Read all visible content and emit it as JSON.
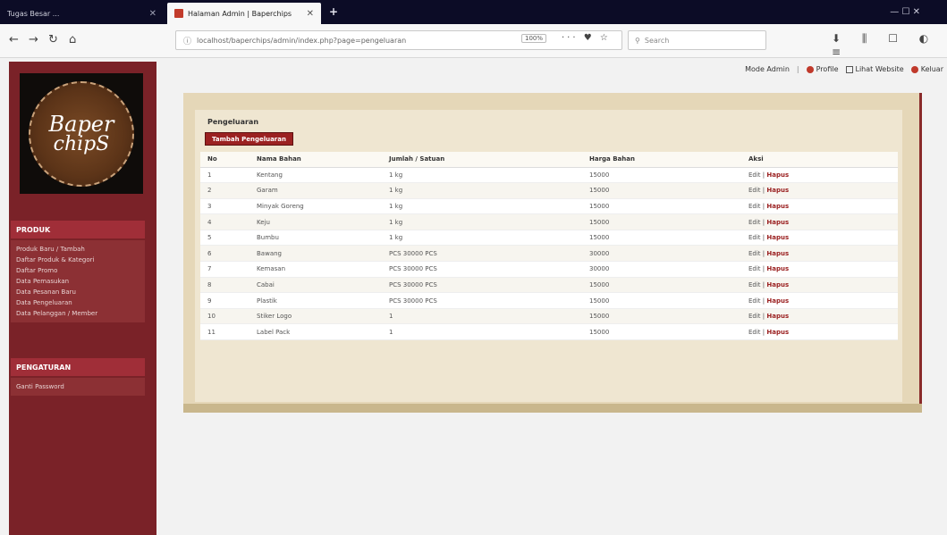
{
  "browser": {
    "tabs": [
      {
        "label": "Tugas Besar ...",
        "active": false
      },
      {
        "label": "Halaman Admin | Baperchips",
        "active": true
      }
    ],
    "new_tab": "+",
    "window_controls": "— ☐ ✕",
    "url": "localhost/baperchips/admin/index.php?page=pengeluaran",
    "zoom": "100%",
    "url_actions": "··· ♥ ☆",
    "search_placeholder": "Search",
    "toolbar_icons": "⬇ ⫼ ☐ ◐ ≡"
  },
  "top_links": {
    "user": "Mode Admin",
    "link1": "Profile",
    "link2": "Lihat Website",
    "link3": "Keluar"
  },
  "logo": {
    "line1": "Baper",
    "line2": "chipS"
  },
  "sidebar": {
    "section1_title": "PRODUK",
    "section1_items": [
      "Produk Baru / Tambah",
      "Daftar Produk & Kategori",
      "Daftar Promo",
      "Data Pemasukan",
      "Data Pesanan Baru",
      "Data Pengeluaran",
      "Data Pelanggan / Member"
    ],
    "section2_title": "PENGATURAN",
    "section2_items": [
      "Ganti Password"
    ]
  },
  "main": {
    "title": "Pengeluaran",
    "add_button": "Tambah Pengeluaran",
    "columns": [
      "No",
      "Nama Bahan",
      "Jumlah / Satuan",
      "Harga Bahan",
      "Aksi"
    ],
    "edit_label": "Edit",
    "delete_label": "Hapus",
    "rows": [
      {
        "no": "1",
        "nama": "Kentang",
        "jumlah": "1 kg",
        "harga": "15000"
      },
      {
        "no": "2",
        "nama": "Garam",
        "jumlah": "1 kg",
        "harga": "15000"
      },
      {
        "no": "3",
        "nama": "Minyak Goreng",
        "jumlah": "1 kg",
        "harga": "15000"
      },
      {
        "no": "4",
        "nama": "Keju",
        "jumlah": "1 kg",
        "harga": "15000"
      },
      {
        "no": "5",
        "nama": "Bumbu",
        "jumlah": "1 kg",
        "harga": "15000"
      },
      {
        "no": "6",
        "nama": "Bawang",
        "jumlah": "PCS 30000 PCS",
        "harga": "30000"
      },
      {
        "no": "7",
        "nama": "Kemasan",
        "jumlah": "PCS 30000 PCS",
        "harga": "30000"
      },
      {
        "no": "8",
        "nama": "Cabai",
        "jumlah": "PCS 30000 PCS",
        "harga": "15000"
      },
      {
        "no": "9",
        "nama": "Plastik",
        "jumlah": "PCS 30000 PCS",
        "harga": "15000"
      },
      {
        "no": "10",
        "nama": "Stiker Logo",
        "jumlah": "1",
        "harga": "15000"
      },
      {
        "no": "11",
        "nama": "Label Pack",
        "jumlah": "1",
        "harga": "15000"
      }
    ]
  }
}
